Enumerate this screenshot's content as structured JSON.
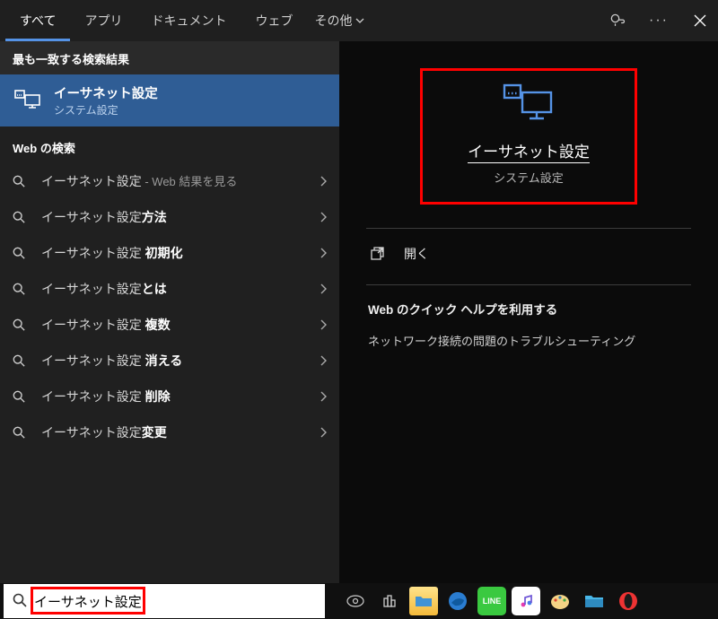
{
  "tabs": {
    "all": "すべて",
    "apps": "アプリ",
    "documents": "ドキュメント",
    "web": "ウェブ",
    "more": "その他"
  },
  "sections": {
    "best_match": "最も一致する検索結果",
    "web_search": "Web の検索"
  },
  "best_match": {
    "title": "イーサネット設定",
    "subtitle": "システム設定"
  },
  "web_items": [
    {
      "prefix": "イーサネット設定",
      "suffix": " - Web 結果を見る",
      "bold": false
    },
    {
      "prefix": "イーサネット設定",
      "suffix": "方法",
      "bold": true
    },
    {
      "prefix": "イーサネット設定",
      "suffix": " 初期化",
      "bold": true
    },
    {
      "prefix": "イーサネット設定",
      "suffix": "とは",
      "bold": true
    },
    {
      "prefix": "イーサネット設定",
      "suffix": " 複数",
      "bold": true
    },
    {
      "prefix": "イーサネット設定",
      "suffix": " 消える",
      "bold": true
    },
    {
      "prefix": "イーサネット設定",
      "suffix": " 削除",
      "bold": true
    },
    {
      "prefix": "イーサネット設定",
      "suffix": "変更",
      "bold": true
    }
  ],
  "preview": {
    "title": "イーサネット設定",
    "subtitle": "システム設定",
    "open_label": "開く",
    "help_header": "Web のクイック ヘルプを利用する",
    "help_line": "ネットワーク接続の問題のトラブルシューティング"
  },
  "search": {
    "value": "イーサネット設定"
  }
}
